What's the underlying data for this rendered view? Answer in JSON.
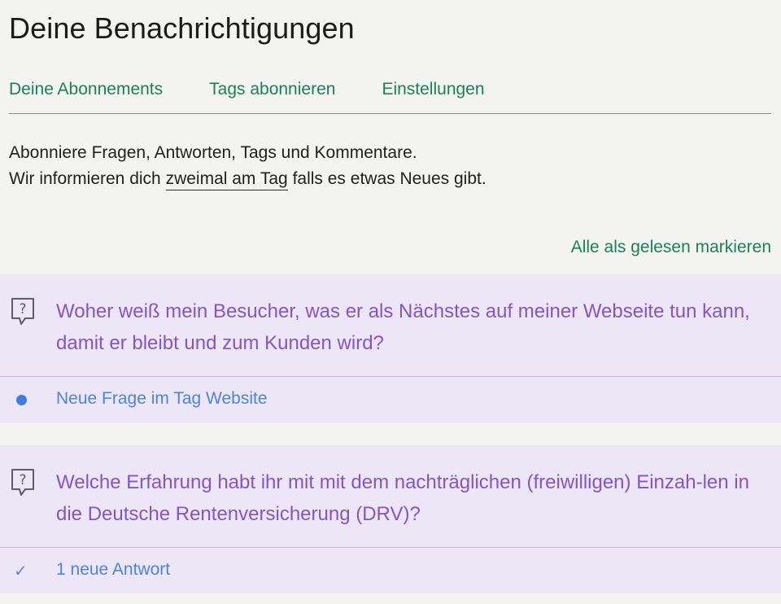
{
  "page": {
    "title": "Deine Benachrichtigungen"
  },
  "tabs": [
    {
      "label": "Deine Abonnements"
    },
    {
      "label": "Tags abonnieren"
    },
    {
      "label": "Einstellungen"
    }
  ],
  "intro": {
    "line1": "Abonniere Fragen, Antworten, Tags und Kommentare.",
    "line2_prefix": "Wir informieren dich ",
    "line2_link": "zweimal am Tag",
    "line2_suffix": " falls es etwas Neues gibt."
  },
  "mark_all_label": "Alle als gelesen markieren",
  "notifications": [
    {
      "title": "Woher weiß mein Besucher, was er als Nächstes auf meiner Webseite tun kann, damit er bleibt und zum Kunden wird?",
      "status": "Neue Frage im Tag Website",
      "indicator": "dot",
      "icon": "question-bubble-icon"
    },
    {
      "title": "Welche Erfahrung habt ihr mit mit dem nachträglichen (freiwilligen) Einzah-len in die Deutsche Rentenversicherung (DRV)?",
      "status": "1 neue Antwort",
      "indicator": "checkmark",
      "icon": "question-bubble-icon"
    }
  ],
  "colors": {
    "accent_green": "#1c7d5f",
    "card_bg": "#ede6f6",
    "question_purple": "#8356c3",
    "status_blue": "#4f84d6",
    "unread_dot": "#3f7de3"
  }
}
